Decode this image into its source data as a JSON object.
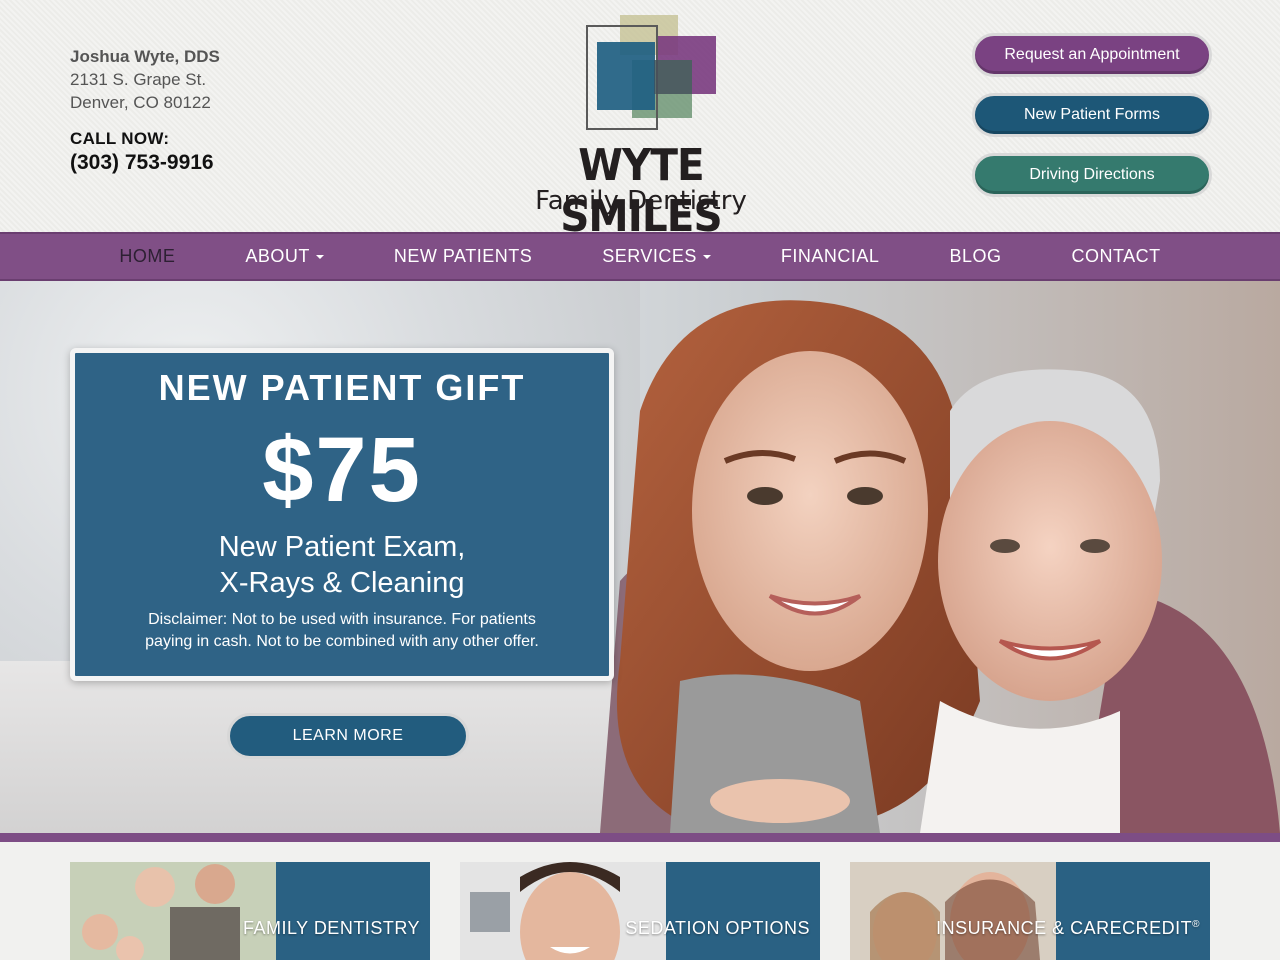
{
  "header": {
    "doctor": "Joshua Wyte, DDS",
    "address_line1": "2131 S. Grape St.",
    "address_line2": "Denver, CO 80122",
    "call_label": "CALL NOW:",
    "phone": "(303) 753-9916",
    "logo": {
      "title": "WYTE SMILES",
      "subtitle": "Family Dentistry",
      "colors": [
        "#1d5777",
        "#6b2a73",
        "#c8c49a",
        "#5c8a64"
      ]
    },
    "buttons": [
      {
        "label": "Request an Appointment",
        "color": "#7a4282"
      },
      {
        "label": "New Patient Forms",
        "color": "#1d5777"
      },
      {
        "label": "Driving Directions",
        "color": "#357a6e"
      }
    ]
  },
  "nav": {
    "color": "#804f86",
    "items": [
      {
        "label": "HOME",
        "active": true,
        "dropdown": false
      },
      {
        "label": "ABOUT",
        "active": false,
        "dropdown": true
      },
      {
        "label": "NEW PATIENTS",
        "active": false,
        "dropdown": false
      },
      {
        "label": "SERVICES",
        "active": false,
        "dropdown": true
      },
      {
        "label": "FINANCIAL",
        "active": false,
        "dropdown": false
      },
      {
        "label": "BLOG",
        "active": false,
        "dropdown": false
      },
      {
        "label": "CONTACT",
        "active": false,
        "dropdown": false
      }
    ]
  },
  "hero": {
    "offer_title": "NEW PATIENT GIFT",
    "offer_price": "$75",
    "offer_line1": "New Patient Exam,",
    "offer_line2": "X-Rays & Cleaning",
    "disclaimer_line1": "Disclaimer: Not to be used with insurance. For patients",
    "disclaimer_line2": "paying in cash. Not to be combined with any other offer.",
    "cta_label": "LEARN MORE"
  },
  "tiles": [
    {
      "label": "FAMILY DENTISTRY"
    },
    {
      "label": "SEDATION OPTIONS"
    },
    {
      "label": "INSURANCE & CARECREDIT",
      "sup": "®"
    }
  ]
}
